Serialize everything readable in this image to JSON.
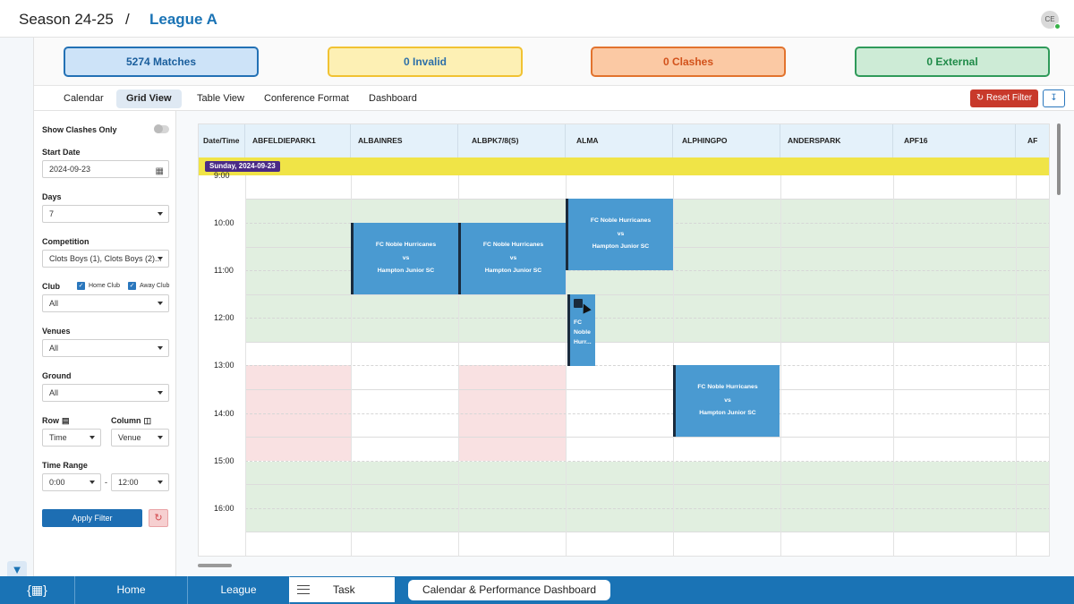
{
  "header": {
    "season": "Season 24-25",
    "separator": "/",
    "league": "League A",
    "avatar_initials": "CE"
  },
  "summary": {
    "matches": "5274 Matches",
    "invalid": "0 Invalid",
    "clashes": "0 Clashes",
    "external": "0 External"
  },
  "tabs": [
    "Calendar",
    "Grid View",
    "Table View",
    "Conference Format",
    "Dashboard"
  ],
  "active_tab": "Grid View",
  "actions": {
    "reset_filter": "Reset Filter",
    "reset_icon": "refresh-icon",
    "download_icon": "download-icon"
  },
  "filters": {
    "show_clashes_only": "Show Clashes Only",
    "start_date_label": "Start Date",
    "start_date_value": "2024-09-23",
    "days_label": "Days",
    "days_value": "7",
    "competition_label": "Competition",
    "competition_value": "Clots Boys (1), Clots Boys (2)...",
    "club_label": "Club",
    "home_club": "Home Club",
    "away_club": "Away Club",
    "club_value": "All",
    "venues_label": "Venues",
    "venues_value": "All",
    "ground_label": "Ground",
    "ground_value": "All",
    "row_label": "Row",
    "row_value": "Time",
    "column_label": "Column",
    "column_value": "Venue",
    "time_range_label": "Time Range",
    "time_from": "0:00",
    "time_sep": "-",
    "time_to": "12:00",
    "apply": "Apply Filter"
  },
  "grid": {
    "corner": "Date/Time",
    "columns": [
      "ABFELDIEPARK1",
      "ALBAINRES",
      "ALBPK7/8(S)",
      "ALMA",
      "ALPHINGPO",
      "ANDERSPARK",
      "APF16",
      "AF"
    ],
    "day": "Sunday, 2024-09-23",
    "times": [
      "9:00",
      "10:00",
      "11:00",
      "12:00",
      "13:00",
      "14:00",
      "15:00",
      "16:00"
    ],
    "match": {
      "home": "FC Noble Hurricanes",
      "vs": "vs",
      "away": "Hampton Junior SC"
    },
    "small_match": [
      "FC",
      "Noble",
      "Hurr..."
    ]
  },
  "bottom_nav": {
    "logo_icon": "calendar-icon",
    "home": "Home",
    "league": "League",
    "task": "Task",
    "dashboard": "Calendar & Performance Dashboard"
  }
}
